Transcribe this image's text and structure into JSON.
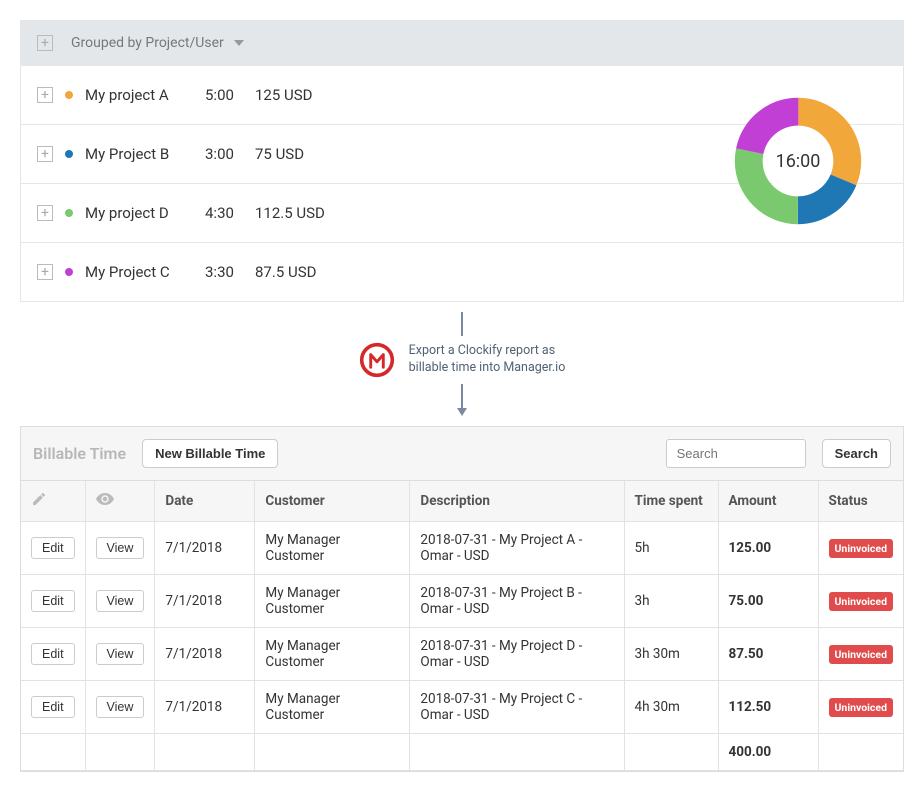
{
  "clockify": {
    "group_label": "Grouped by Project/User",
    "rows": [
      {
        "name": "My project A",
        "time": "5:00",
        "amount": "125 USD",
        "color": "#f2a73b"
      },
      {
        "name": "My Project B",
        "time": "3:00",
        "amount": "75 USD",
        "color": "#1f77b4"
      },
      {
        "name": "My project D",
        "time": "4:30",
        "amount": "112.5 USD",
        "color": "#7bc96f"
      },
      {
        "name": "My Project C",
        "time": "3:30",
        "amount": "87.5 USD",
        "color": "#c23fd6"
      }
    ],
    "donut_center": "16:00"
  },
  "chart_data": {
    "type": "pie",
    "title": "",
    "categories": [
      "My project A",
      "My Project B",
      "My project D",
      "My Project C"
    ],
    "values": [
      5.0,
      3.0,
      4.5,
      3.5
    ],
    "colors": [
      "#f2a73b",
      "#1f77b4",
      "#7bc96f",
      "#c23fd6"
    ],
    "total_label": "16:00"
  },
  "flow": {
    "line1": "Export a Clockify report as",
    "line2": "billable time into Manager.io"
  },
  "manager": {
    "title": "Billable Time",
    "new_button": "New Billable Time",
    "search_placeholder": "Search",
    "search_button": "Search",
    "headers": {
      "date": "Date",
      "customer": "Customer",
      "description": "Description",
      "time_spent": "Time spent",
      "amount": "Amount",
      "status": "Status"
    },
    "buttons": {
      "edit": "Edit",
      "view": "View"
    },
    "status_label": "Uninvoiced",
    "rows": [
      {
        "date": "7/1/2018",
        "customer": "My Manager Customer",
        "description": "2018-07-31 - My Project A - Omar - USD",
        "time_spent": "5h",
        "amount": "125.00"
      },
      {
        "date": "7/1/2018",
        "customer": "My Manager Customer",
        "description": "2018-07-31 - My Project B - Omar - USD",
        "time_spent": "3h",
        "amount": "75.00"
      },
      {
        "date": "7/1/2018",
        "customer": "My Manager Customer",
        "description": "2018-07-31 - My Project D - Omar - USD",
        "time_spent": "3h 30m",
        "amount": "87.50"
      },
      {
        "date": "7/1/2018",
        "customer": "My Manager Customer",
        "description": "2018-07-31 - My Project C - Omar - USD",
        "time_spent": "4h 30m",
        "amount": "112.50"
      }
    ],
    "total": "400.00"
  }
}
